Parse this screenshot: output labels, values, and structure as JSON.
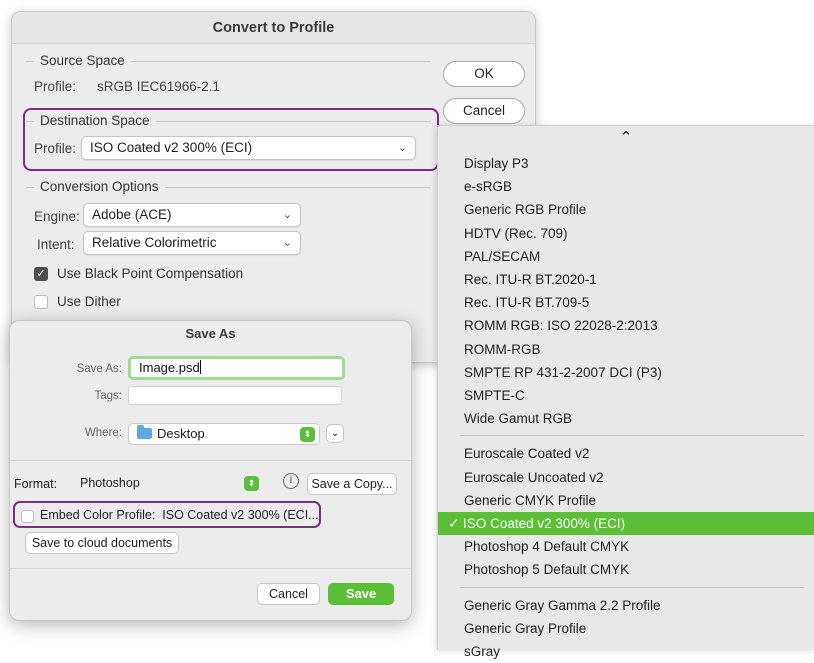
{
  "convert_dialog": {
    "title": "Convert to Profile",
    "source": {
      "label": "Source Space",
      "profile_label": "Profile:",
      "profile_value": "sRGB IEC61966-2.1"
    },
    "destination": {
      "label": "Destination Space",
      "profile_label": "Profile:",
      "profile_value": "ISO Coated v2 300% (ECI)"
    },
    "options": {
      "label": "Conversion Options",
      "engine_label": "Engine:",
      "engine_value": "Adobe (ACE)",
      "intent_label": "Intent:",
      "intent_value": "Relative Colorimetric",
      "black_point": "Use Black Point Compensation",
      "black_point_checked": true,
      "dither": "Use Dither",
      "dither_checked": false
    },
    "ok_label": "OK",
    "cancel_label": "Cancel"
  },
  "dropdown": {
    "group1": [
      "Display P3",
      "e-sRGB",
      "Generic RGB Profile",
      "HDTV (Rec. 709)",
      "PAL/SECAM",
      "Rec. ITU-R BT.2020-1",
      "Rec. ITU-R BT.709-5",
      "ROMM RGB: ISO 22028-2:2013",
      "ROMM-RGB",
      "SMPTE RP 431-2-2007 DCI (P3)",
      "SMPTE-C",
      "Wide Gamut RGB"
    ],
    "group2": [
      "Euroscale Coated v2",
      "Euroscale Uncoated v2",
      "Generic CMYK Profile",
      "ISO Coated v2 300% (ECI)",
      "Photoshop 4 Default CMYK",
      "Photoshop 5 Default CMYK"
    ],
    "group3": [
      "Generic Gray Gamma 2.2 Profile",
      "Generic Gray Profile",
      "sGray"
    ],
    "selected": "ISO Coated v2 300% (ECI)",
    "check_mark": "✓"
  },
  "save_dialog": {
    "title": "Save As",
    "save_as_label": "Save As:",
    "save_as_value": "Image.psd",
    "tags_label": "Tags:",
    "where_label": "Where:",
    "where_value": "Desktop",
    "format_label": "Format:",
    "format_value": "Photoshop",
    "save_copy_label": "Save a Copy...",
    "embed_label": "Embed Color Profile:  ISO Coated v2 300% (ECI...",
    "embed_checked": false,
    "cloud_label": "Save to cloud documents",
    "cancel_label": "Cancel",
    "save_label": "Save"
  },
  "colors": {
    "accent_green": "#5bbf37",
    "highlight_purple": "#7b2d83",
    "focus_ring": "#a4dc8e"
  }
}
